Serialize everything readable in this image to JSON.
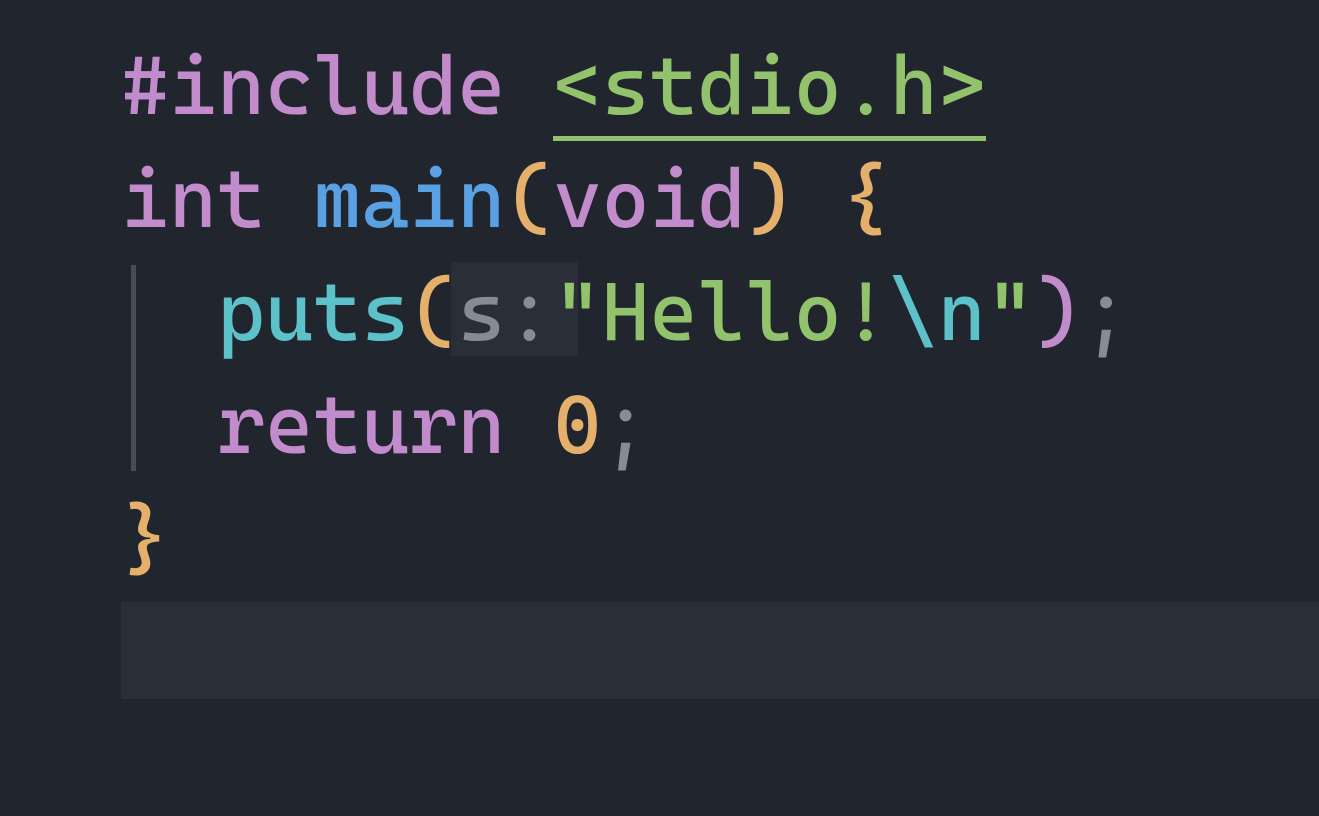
{
  "code": {
    "line1": {
      "include": "#include",
      "header": "<stdio.h>"
    },
    "line2": {
      "type": "int",
      "name": "main",
      "paren_open": "(",
      "void": "void",
      "paren_close": ")",
      "brace_open": "{"
    },
    "line3": {
      "indent": "  ",
      "func": "puts",
      "paren_open": "(",
      "hint": "s:",
      "string_open": "\"",
      "string_body": "Hello!",
      "escape": "\\n",
      "string_close": "\"",
      "paren_close": ")",
      "semi": ";"
    },
    "line4": {
      "indent": "  ",
      "return": "return",
      "zero": "0",
      "semi": ";"
    },
    "line5": {
      "brace_close": "}"
    }
  }
}
